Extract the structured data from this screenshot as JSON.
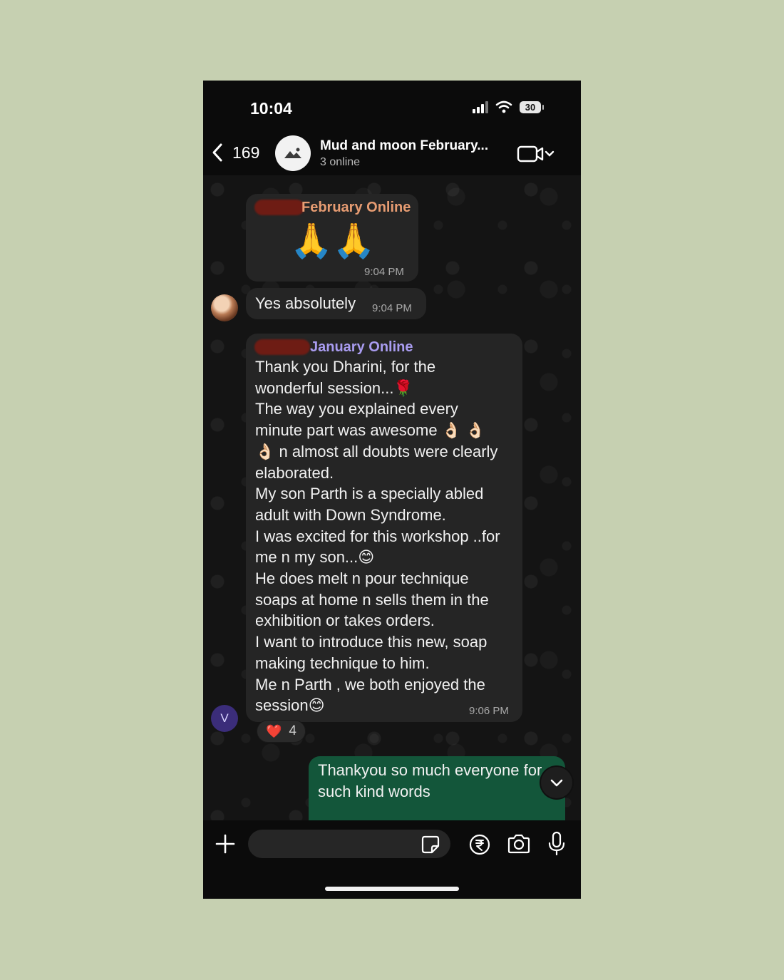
{
  "status_bar": {
    "time": "10:04",
    "battery": "30"
  },
  "header": {
    "back_count": "169",
    "group_name": "Mud and moon February...",
    "online_status": "3 online"
  },
  "messages": [
    {
      "sender": "February Online",
      "sender_color": "#e79c72",
      "text": "🙏🙏",
      "time": "9:04 PM"
    },
    {
      "text": "Yes absolutely",
      "time": "9:04 PM"
    },
    {
      "sender": "January Online",
      "sender_color": "#a99cf0",
      "lines": [
        "Thank you Dharini, for the",
        "wonderful session...🌹",
        "The way you explained every",
        "minute part was awesome 👌🏻 👌🏻",
        "👌🏻 n almost all doubts were clearly",
        "elaborated.",
        "My son Parth is a specially abled",
        "adult with Down Syndrome.",
        "I was excited for this workshop ..for",
        "me n my son...😊",
        "He does melt n pour technique",
        "soaps at home n sells them in the",
        "exhibition or takes orders.",
        "I want to introduce this new, soap",
        "making technique to him.",
        "Me n Parth , we both enjoyed the",
        "session😊"
      ],
      "time": "9:06 PM",
      "avatar_letter": "V",
      "reaction": {
        "emoji": "❤️",
        "count": "4"
      }
    },
    {
      "lines": [
        "Thankyou so much everyone for",
        "such kind words"
      ],
      "outgoing": true
    }
  ],
  "composer": {
    "value": "",
    "placeholder": ""
  },
  "colors": {
    "background": "#c6d0b1",
    "outgoing_bubble": "#13563a",
    "incoming_bubble": "#252525"
  }
}
